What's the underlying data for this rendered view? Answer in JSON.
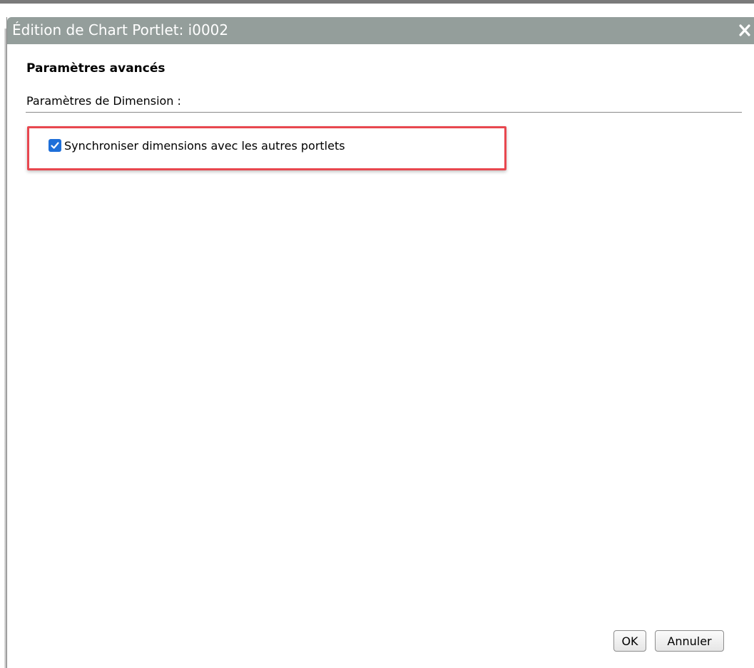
{
  "dialog": {
    "title": "Édition de Chart Portlet: i0002",
    "close_icon": "close-icon",
    "titlebar_color": "#949e9b"
  },
  "content": {
    "section_heading": "Paramètres avancés",
    "subsection_label": "Paramètres de Dimension :",
    "sync_checkbox": {
      "label": "Synchroniser dimensions avec les autres portlets",
      "checked": true,
      "check_color": "#1e6fd9"
    },
    "highlight_color": "#e8474f"
  },
  "buttons": {
    "ok_label": "OK",
    "cancel_label": "Annuler"
  }
}
